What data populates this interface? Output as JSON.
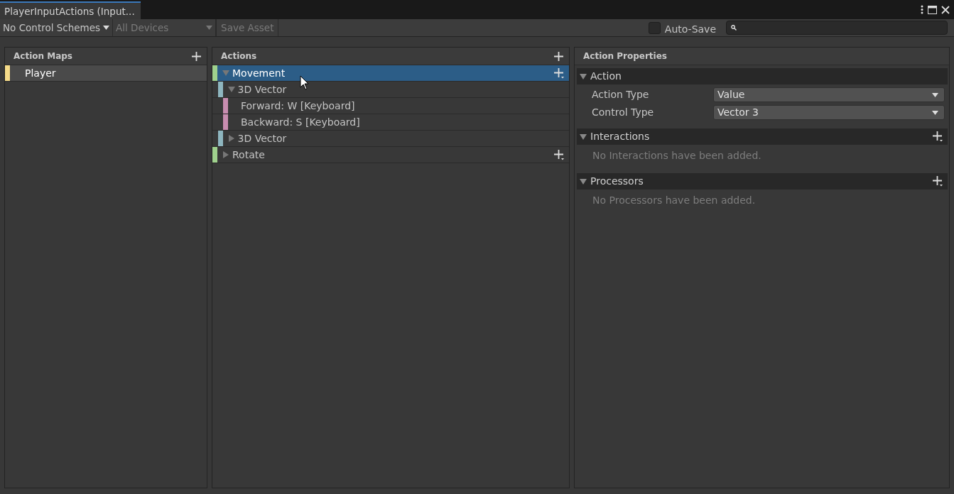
{
  "window": {
    "tab_title": "PlayerInputActions (Input..."
  },
  "toolbar": {
    "control_schemes": "No Control Schemes",
    "devices": {
      "label": "All Devices",
      "disabled": true
    },
    "save_asset": {
      "label": "Save Asset",
      "disabled": true
    },
    "auto_save": {
      "label": "Auto-Save",
      "checked": false
    }
  },
  "action_maps": {
    "title": "Action Maps",
    "items": [
      {
        "label": "Player",
        "selected": true
      }
    ]
  },
  "actions": {
    "title": "Actions",
    "items": [
      {
        "kind": "action",
        "label": "Movement",
        "selected": true,
        "expanded": true,
        "children": [
          {
            "kind": "composite",
            "label": "3D Vector",
            "selected": false,
            "expanded": true,
            "children": [
              {
                "kind": "binding",
                "label": "Forward: W [Keyboard]",
                "selected": false
              },
              {
                "kind": "binding",
                "label": "Backward: S [Keyboard]",
                "selected": false
              }
            ]
          },
          {
            "kind": "composite",
            "label": "3D Vector",
            "selected": false,
            "expanded": false
          }
        ]
      },
      {
        "kind": "action",
        "label": "Rotate",
        "selected": false,
        "expanded": false
      }
    ]
  },
  "properties": {
    "title": "Action Properties",
    "sections": [
      {
        "kind": "fields",
        "title": "Action",
        "expanded": true,
        "fields": [
          {
            "label": "Action Type",
            "value": "Value"
          },
          {
            "label": "Control Type",
            "value": "Vector 3"
          }
        ]
      },
      {
        "kind": "list",
        "title": "Interactions",
        "expanded": true,
        "empty_text": "No Interactions have been added."
      },
      {
        "kind": "list",
        "title": "Processors",
        "expanded": true,
        "empty_text": "No Processors have been added."
      }
    ]
  }
}
